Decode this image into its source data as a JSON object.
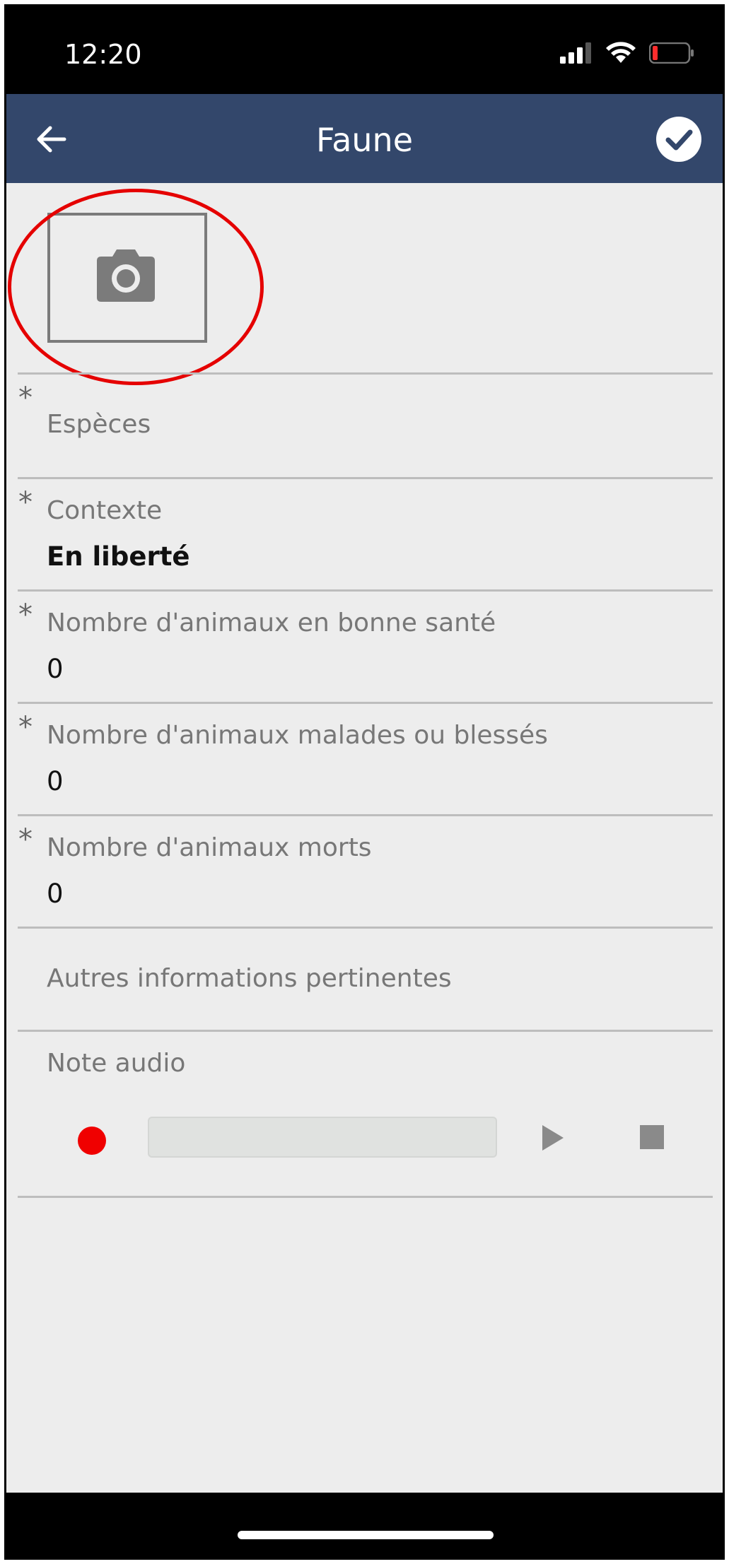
{
  "status_bar": {
    "time": "12:20",
    "icons": [
      "signal-icon",
      "wifi-icon",
      "battery-low-icon"
    ]
  },
  "app_bar": {
    "title": "Faune",
    "back_icon": "arrow-left-icon",
    "confirm_icon": "check-circle-icon",
    "background_color": "#33476b"
  },
  "photo": {
    "icon": "camera-icon"
  },
  "fields": [
    {
      "required": true,
      "asterisk": "*",
      "label": "Espèces",
      "value": ""
    },
    {
      "required": true,
      "asterisk": "*",
      "label": "Contexte",
      "value": "En liberté"
    },
    {
      "required": true,
      "asterisk": "*",
      "label": "Nombre d'animaux en bonne santé",
      "value": "0"
    },
    {
      "required": true,
      "asterisk": "*",
      "label": "Nombre d'animaux malades ou blessés",
      "value": "0"
    },
    {
      "required": true,
      "asterisk": "*",
      "label": "Nombre d'animaux morts",
      "value": "0"
    },
    {
      "required": false,
      "asterisk": "",
      "label": "Autres informations pertinentes",
      "value": ""
    }
  ],
  "audio_note": {
    "label": "Note audio",
    "record_icon": "record-icon",
    "play_icon": "play-icon",
    "stop_icon": "stop-icon"
  },
  "colors": {
    "accent_red": "#e50000",
    "record_red": "#f00000",
    "background": "#ededed"
  }
}
